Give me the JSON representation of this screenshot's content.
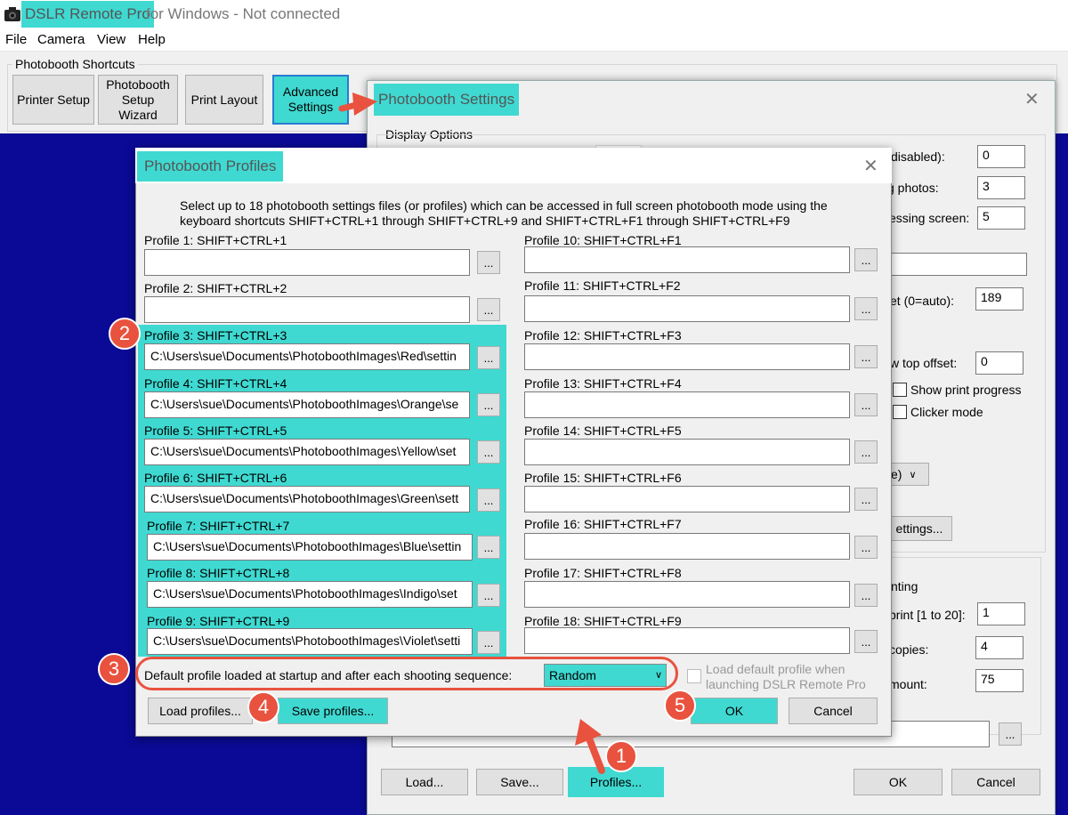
{
  "window": {
    "app_name": "DSLR Remote Pro",
    "title_suffix": "for Windows - Not connected"
  },
  "menu": [
    "File",
    "Camera",
    "View",
    "Help"
  ],
  "shortcuts": {
    "group_label": "Photobooth Shortcuts",
    "buttons": [
      "Printer Setup",
      "Photobooth Setup Wizard",
      "Print Layout",
      "Advanced Settings"
    ]
  },
  "settings_dialog": {
    "title": "Photobooth Settings",
    "display_options_label": "Display Options",
    "rows": [
      {
        "label": "disabled):",
        "value": "0"
      },
      {
        "label": "g photos:",
        "value": "3"
      },
      {
        "label": "essing screen:",
        "value": "5"
      },
      {
        "label": "et (0=auto):",
        "value": "189"
      },
      {
        "label": "w top offset:",
        "value": "0"
      }
    ],
    "show_print_progress": "Show print progress",
    "clicker_mode": "Clicker mode",
    "dropdown_fragment": "e)",
    "settings_button_fragment": "ettings...",
    "printing_fragment": "nting",
    "print_rows": [
      {
        "label": "print [1 to 20]:",
        "value": "1"
      },
      {
        "label": "copies:",
        "value": "4"
      },
      {
        "label": "mount:",
        "value": "75"
      }
    ],
    "dots": "...",
    "buttons": {
      "load": "Load...",
      "save": "Save...",
      "profiles": "Profiles...",
      "ok": "OK",
      "cancel": "Cancel"
    }
  },
  "profiles_dialog": {
    "title": "Photobooth Profiles",
    "description": "Select up to 18 photobooth settings files (or profiles) which can be accessed in full screen photobooth mode using the keyboard shortcuts SHIFT+CTRL+1 through SHIFT+CTRL+9 and SHIFT+CTRL+F1 through SHIFT+CTRL+F9",
    "profiles_left": [
      {
        "label": "Profile 1: SHIFT+CTRL+1",
        "value": ""
      },
      {
        "label": "Profile 2: SHIFT+CTRL+2",
        "value": ""
      },
      {
        "label": "Profile 3: SHIFT+CTRL+3",
        "value": "C:\\Users\\sue\\Documents\\PhotoboothImages\\Red\\settin"
      },
      {
        "label": "Profile 4: SHIFT+CTRL+4",
        "value": "C:\\Users\\sue\\Documents\\PhotoboothImages\\Orange\\se"
      },
      {
        "label": "Profile 5: SHIFT+CTRL+5",
        "value": "C:\\Users\\sue\\Documents\\PhotoboothImages\\Yellow\\set"
      },
      {
        "label": "Profile 6: SHIFT+CTRL+6",
        "value": "C:\\Users\\sue\\Documents\\PhotoboothImages\\Green\\sett"
      },
      {
        "label": "Profile 7: SHIFT+CTRL+7",
        "value": "C:\\Users\\sue\\Documents\\PhotoboothImages\\Blue\\settin"
      },
      {
        "label": "Profile 8: SHIFT+CTRL+8",
        "value": "C:\\Users\\sue\\Documents\\PhotoboothImages\\Indigo\\set"
      },
      {
        "label": "Profile 9: SHIFT+CTRL+9",
        "value": "C:\\Users\\sue\\Documents\\PhotoboothImages\\Violet\\setti"
      }
    ],
    "profiles_right": [
      {
        "label": "Profile 10: SHIFT+CTRL+F1",
        "value": ""
      },
      {
        "label": "Profile 11: SHIFT+CTRL+F2",
        "value": ""
      },
      {
        "label": "Profile 12: SHIFT+CTRL+F3",
        "value": ""
      },
      {
        "label": "Profile 13: SHIFT+CTRL+F4",
        "value": ""
      },
      {
        "label": "Profile 14: SHIFT+CTRL+F5",
        "value": ""
      },
      {
        "label": "Profile 15: SHIFT+CTRL+F6",
        "value": ""
      },
      {
        "label": "Profile 16: SHIFT+CTRL+F7",
        "value": ""
      },
      {
        "label": "Profile 17: SHIFT+CTRL+F8",
        "value": ""
      },
      {
        "label": "Profile 18: SHIFT+CTRL+F9",
        "value": ""
      }
    ],
    "dots": "...",
    "default_label": "Default profile loaded at startup and after each shooting sequence:",
    "default_value": "Random",
    "load_default_label": "Load default profile when launching DSLR Remote Pro",
    "buttons": {
      "load_profiles": "Load profiles...",
      "save_profiles": "Save profiles...",
      "ok": "OK",
      "cancel": "Cancel"
    }
  },
  "annotations": [
    "1",
    "2",
    "3",
    "4",
    "5"
  ],
  "colors": {
    "highlight": "#3fd9d1",
    "annotation": "#e8523e",
    "desktop": "#0a0a96"
  }
}
